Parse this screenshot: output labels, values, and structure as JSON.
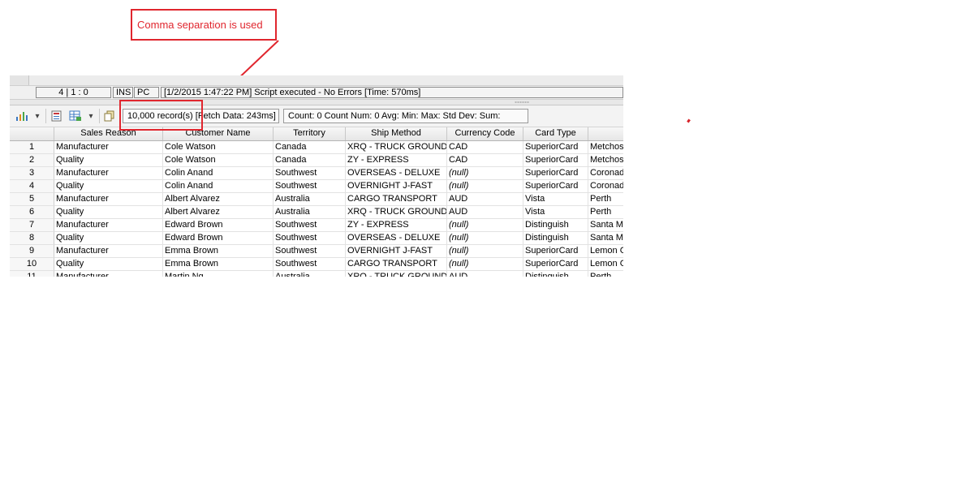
{
  "callout": {
    "text": "Comma separation is used"
  },
  "statusbar": {
    "position": "4 | 1 : 0",
    "mode": "INS",
    "machine": "PC",
    "message": "[1/2/2015 1:47:22 PM] Script executed - No Errors [Time: 570ms]"
  },
  "toolbar": {
    "records": "10,000 record(s) [Fetch Data: 243ms]",
    "stats": "Count: 0  Count Num: 0  Avg:   Min:   Max:  Std Dev:   Sum:"
  },
  "grid": {
    "columns": [
      "",
      "Sales Reason",
      "Customer Name",
      "Territory",
      "Ship Method",
      "Currency Code",
      "Card Type",
      ""
    ],
    "rows": [
      [
        "1",
        "Manufacturer",
        "Cole Watson",
        "Canada",
        "XRQ - TRUCK GROUND",
        "CAD",
        "SuperiorCard",
        "Metchosin"
      ],
      [
        "2",
        "Quality",
        "Cole Watson",
        "Canada",
        "ZY - EXPRESS",
        "CAD",
        "SuperiorCard",
        "Metchosin"
      ],
      [
        "3",
        "Manufacturer",
        "Colin Anand",
        "Southwest",
        "OVERSEAS - DELUXE",
        "(null)",
        "SuperiorCard",
        "Coronado"
      ],
      [
        "4",
        "Quality",
        "Colin Anand",
        "Southwest",
        "OVERNIGHT J-FAST",
        "(null)",
        "SuperiorCard",
        "Coronado"
      ],
      [
        "5",
        "Manufacturer",
        "Albert Alvarez",
        "Australia",
        "CARGO TRANSPORT",
        "AUD",
        "Vista",
        "Perth"
      ],
      [
        "6",
        "Quality",
        "Albert Alvarez",
        "Australia",
        "XRQ - TRUCK GROUND",
        "AUD",
        "Vista",
        "Perth"
      ],
      [
        "7",
        "Manufacturer",
        "Edward Brown",
        "Southwest",
        "ZY - EXPRESS",
        "(null)",
        "Distinguish",
        "Santa Monica"
      ],
      [
        "8",
        "Quality",
        "Edward Brown",
        "Southwest",
        "OVERSEAS - DELUXE",
        "(null)",
        "Distinguish",
        "Santa Monica"
      ],
      [
        "9",
        "Manufacturer",
        "Emma Brown",
        "Southwest",
        "OVERNIGHT J-FAST",
        "(null)",
        "SuperiorCard",
        "Lemon Grove"
      ],
      [
        "10",
        "Quality",
        "Emma Brown",
        "Southwest",
        "CARGO TRANSPORT",
        "(null)",
        "SuperiorCard",
        "Lemon Grove"
      ],
      [
        "11",
        "Manufacturer",
        "Martin Ng",
        "Australia",
        "XRQ - TRUCK GROUND",
        "AUD",
        "Distinguish",
        "Perth"
      ]
    ]
  },
  "icons": {
    "chart": "chart-icon",
    "export": "export-icon",
    "grid-options": "grid-options-icon",
    "copy": "copy-icon",
    "dropdown": "chevron-down-icon"
  },
  "colors": {
    "annotation": "#e0262e",
    "icon_accent": "#3b78c2"
  }
}
